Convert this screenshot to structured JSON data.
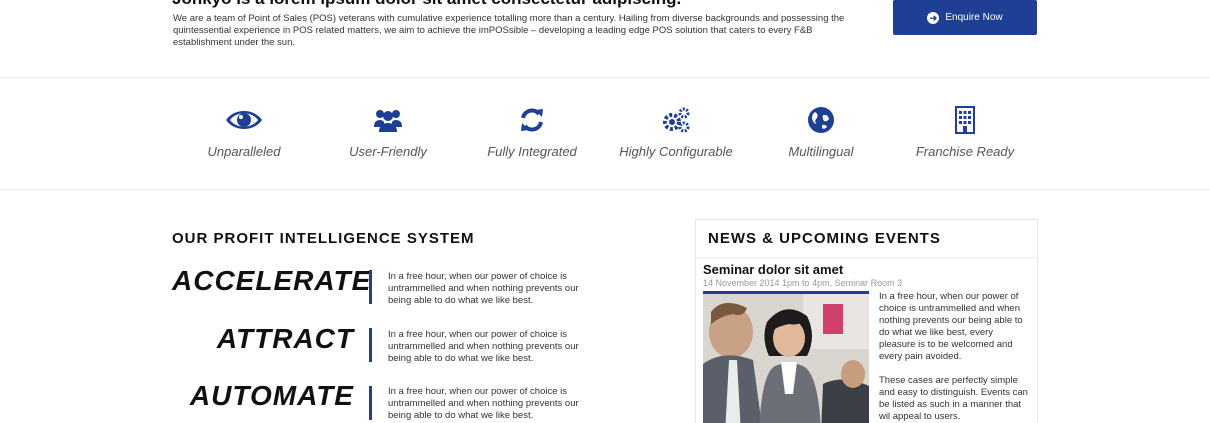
{
  "top": {
    "heading": "Jonkyo is a lorem ipsum dolor sit amet consectetur adipiscing.",
    "intro": "We are a team of Point of Sales (POS) veterans with cumulative experience totalling more than a century. Hailing from diverse backgrounds and possessing the quintessential experience in POS related matters, we aim to achieve the imPOSsible – developing a leading edge POS solution that caters to every F&B establishment under the sun.",
    "enquire_label": "Enquire Now"
  },
  "features": [
    {
      "label": "Unparalleled",
      "icon": "eye-icon"
    },
    {
      "label": "User-Friendly",
      "icon": "users-icon"
    },
    {
      "label": "Fully Integrated",
      "icon": "sync-icon"
    },
    {
      "label": "Highly Configurable",
      "icon": "gears-icon"
    },
    {
      "label": "Multilingual",
      "icon": "globe-icon"
    },
    {
      "label": "Franchise Ready",
      "icon": "building-icon"
    }
  ],
  "profit": {
    "title": "OUR PROFIT INTELLIGENCE SYSTEM",
    "items": [
      {
        "word": "ACCELERATE",
        "desc": "In a free hour, when our power of choice is untrammelled and when nothing prevents our being able to do what we like best."
      },
      {
        "word": "ATTRACT",
        "desc": "In a free hour, when our power of choice is untrammelled and when nothing prevents our being able to do what we like best."
      },
      {
        "word": "AUTOMATE",
        "desc": "In a free hour, when our power of choice is untrammelled and when nothing prevents our being able to do what we like best."
      }
    ]
  },
  "news": {
    "title": "NEWS & UPCOMING EVENTS",
    "event": {
      "title": "Seminar dolor sit amet",
      "meta": "14 November 2014 1pm to 4pm, Seminar Room 3",
      "para1": "In a free hour, when our power of choice is untrammelled and when nothing prevents our being able to do what we like best, every pleasure is to be welcomed and every pain avoided.",
      "para2": "These cases are perfectly simple and easy to distinguish. Events can be listed as such in a manner that wil appeal to users."
    }
  },
  "colors": {
    "accent": "#1f3f94",
    "divider": "#ececec"
  }
}
